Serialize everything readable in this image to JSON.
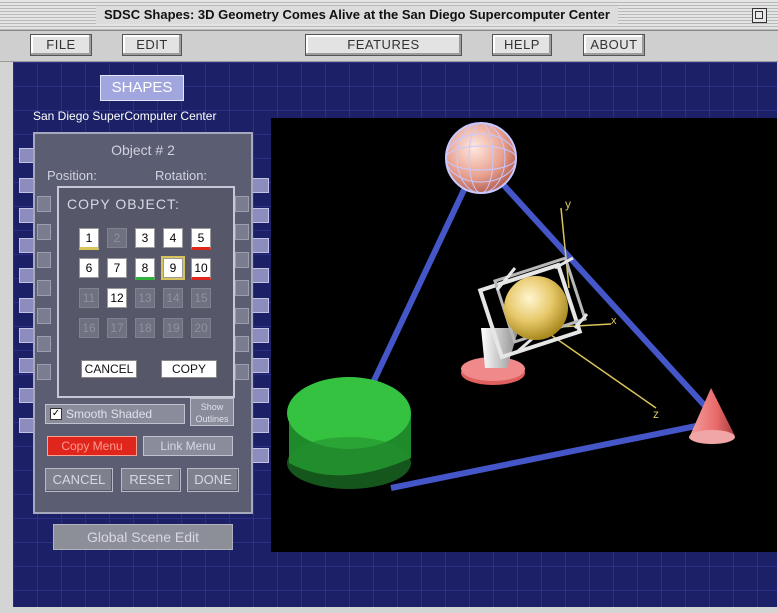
{
  "window": {
    "title": "SDSC Shapes: 3D Geometry Comes Alive at the San Diego Supercomputer Center"
  },
  "menu": {
    "file": "FILE",
    "edit": "EDIT",
    "features": "FEATURES",
    "help": "HELP",
    "about": "ABOUT"
  },
  "left": {
    "shapes_button": "SHAPES",
    "org_label": "San Diego SuperComputer Center",
    "global_edit": "Global Scene Edit"
  },
  "object_panel": {
    "title": "Object # 2",
    "position_label": "Position:",
    "rotation_label": "Rotation:",
    "smooth_shaded": "Smooth Shaded",
    "show_outlines": "Show Outlines",
    "copy_menu": "Copy Menu",
    "link_menu": "Link Menu",
    "cancel": "CANCEL",
    "reset": "RESET",
    "done": "DONE"
  },
  "copy_dialog": {
    "title": "COPY OBJECT:",
    "buttons": [
      {
        "label": "1",
        "enabled": true,
        "color": "#d8c45a"
      },
      {
        "label": "2",
        "enabled": false
      },
      {
        "label": "3",
        "enabled": true
      },
      {
        "label": "4",
        "enabled": true
      },
      {
        "label": "5",
        "enabled": true,
        "color": "#e0251c"
      },
      {
        "label": "6",
        "enabled": true
      },
      {
        "label": "7",
        "enabled": true
      },
      {
        "label": "8",
        "enabled": true,
        "color": "#2fb33a"
      },
      {
        "label": "9",
        "enabled": true,
        "selected": true
      },
      {
        "label": "10",
        "enabled": true,
        "color": "#e0251c"
      },
      {
        "label": "11",
        "enabled": false
      },
      {
        "label": "12",
        "enabled": true
      },
      {
        "label": "13",
        "enabled": false
      },
      {
        "label": "14",
        "enabled": false
      },
      {
        "label": "15",
        "enabled": false
      },
      {
        "label": "16",
        "enabled": false
      },
      {
        "label": "17",
        "enabled": false
      },
      {
        "label": "18",
        "enabled": false
      },
      {
        "label": "19",
        "enabled": false
      },
      {
        "label": "20",
        "enabled": false
      }
    ],
    "cancel": "CANCEL",
    "copy": "COPY"
  },
  "scene": {
    "axis_x": "x",
    "axis_y": "y",
    "axis_z": "z"
  },
  "colors": {
    "stage": "#1c2066",
    "link_line": "#4556c8",
    "cylinder": "#2fb33a",
    "cone": "#e86a6a",
    "sphere": "#e7c86a",
    "axis": "#d8c45a"
  }
}
